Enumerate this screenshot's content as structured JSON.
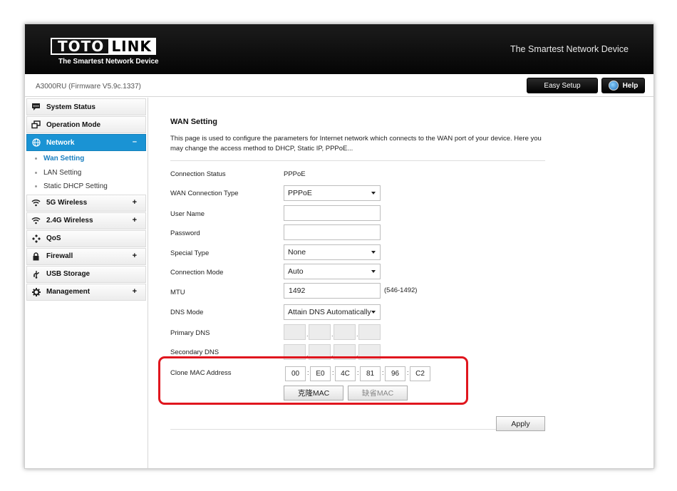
{
  "header": {
    "logo_left": "TOTO",
    "logo_right": "LINK",
    "logo_tagline": "The Smartest Network Device",
    "slogan": "The Smartest Network Device"
  },
  "subbar": {
    "model": "A3000RU (Firmware V5.9c.1337)",
    "easy_setup": "Easy Setup",
    "help": "Help"
  },
  "sidebar": {
    "items": [
      {
        "label": "System Status",
        "icon": "chat-icon",
        "expandable": false
      },
      {
        "label": "Operation Mode",
        "icon": "windows-icon",
        "expandable": false
      },
      {
        "label": "Network",
        "icon": "globe-icon",
        "expandable": true,
        "toggle": "–"
      },
      {
        "label": "5G Wireless",
        "icon": "wifi-icon",
        "expandable": true,
        "toggle": "+"
      },
      {
        "label": "2.4G Wireless",
        "icon": "wifi-icon",
        "expandable": true,
        "toggle": "+"
      },
      {
        "label": "QoS",
        "icon": "qos-icon",
        "expandable": false
      },
      {
        "label": "Firewall",
        "icon": "lock-icon",
        "expandable": true,
        "toggle": "+"
      },
      {
        "label": "USB Storage",
        "icon": "usb-icon",
        "expandable": false
      },
      {
        "label": "Management",
        "icon": "gear-icon",
        "expandable": true,
        "toggle": "+"
      }
    ],
    "network_sub": [
      "Wan Setting",
      "LAN Setting",
      "Static DHCP Setting"
    ]
  },
  "content": {
    "title": "WAN Setting",
    "description": "This page is used to configure the parameters for Internet network which connects to the WAN port of your device. Here you may change the access method to DHCP, Static IP, PPPoE...",
    "connection_status_label": "Connection Status",
    "connection_status_value": "PPPoE",
    "wan_type_label": "WAN Connection Type",
    "wan_type_value": "PPPoE",
    "username_label": "User Name",
    "username_value": "",
    "password_label": "Password",
    "password_value": "",
    "special_type_label": "Special Type",
    "special_type_value": "None",
    "conn_mode_label": "Connection Mode",
    "conn_mode_value": "Auto",
    "mtu_label": "MTU",
    "mtu_value": "1492",
    "mtu_hint": "(546-1492)",
    "dns_mode_label": "DNS Mode",
    "dns_mode_value": "Attain DNS Automatically",
    "primary_dns_label": "Primary DNS",
    "secondary_dns_label": "Secondary DNS",
    "clone_mac_label": "Clone MAC Address",
    "mac": [
      "00",
      "E0",
      "4C",
      "81",
      "96",
      "C2"
    ],
    "clone_btn": "克隆MAC",
    "default_btn": "缺省MAC",
    "apply": "Apply"
  },
  "colors": {
    "active_nav": "#1a93d4",
    "highlight": "#e0161e"
  }
}
